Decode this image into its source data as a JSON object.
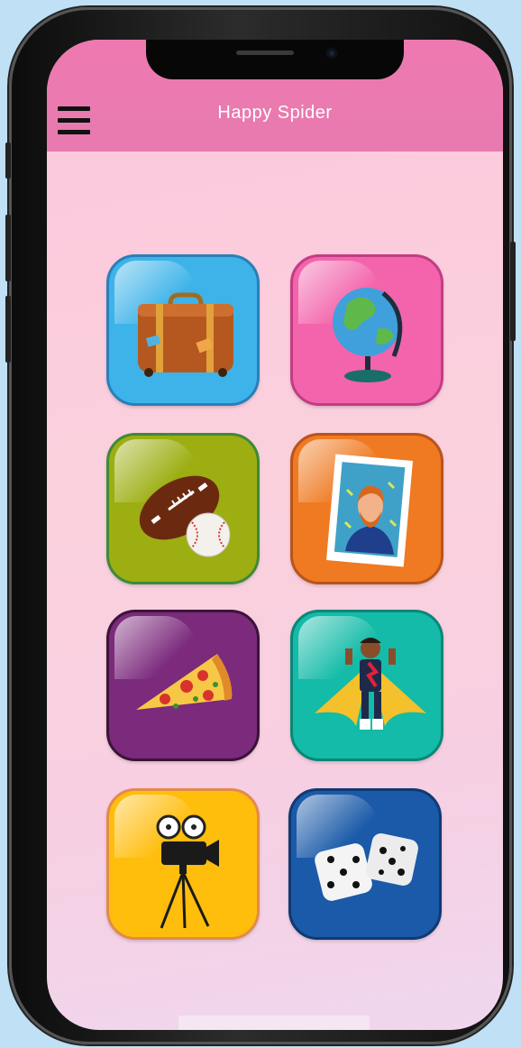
{
  "app": {
    "title": "Happy Spider"
  },
  "colors": {
    "appbar": "#ea79b0",
    "tile_travel": "#3db3e9",
    "tile_geography": "#f364ac",
    "tile_sports": "#9cae11",
    "tile_art": "#ef7a22",
    "tile_food": "#7b2a7c",
    "tile_heroes": "#13bba8",
    "tile_movies": "#ffbd0c",
    "tile_games": "#1a5aa8"
  },
  "categories": [
    {
      "icon": "suitcase-icon"
    },
    {
      "icon": "globe-icon"
    },
    {
      "icon": "football-baseball-icon"
    },
    {
      "icon": "portrait-painting-icon"
    },
    {
      "icon": "pizza-slice-icon"
    },
    {
      "icon": "superhero-icon"
    },
    {
      "icon": "movie-camera-icon"
    },
    {
      "icon": "dice-icon"
    }
  ]
}
